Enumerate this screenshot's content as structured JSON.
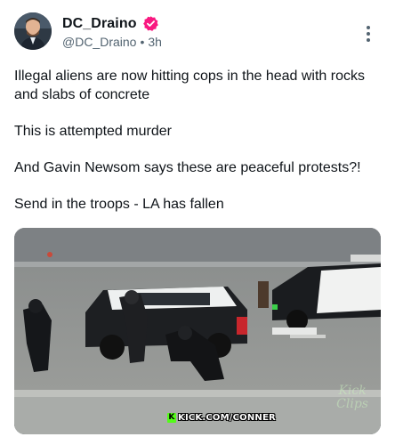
{
  "author": {
    "display_name": "DC_Draino",
    "handle": "@DC_Draino",
    "separator": "•",
    "time_ago": "3h",
    "verified_badge_icon": "verified-badge-icon",
    "badge_color": "#f91880"
  },
  "menu": {
    "icon": "more-vertical-icon"
  },
  "post": {
    "paragraphs": [
      "Illegal aliens are now hitting cops in the head with rocks and slabs of concrete",
      "This is attempted murder",
      "And Gavin Newsom says these are peaceful protests?!",
      "Send in the troops - LA has fallen"
    ]
  },
  "media": {
    "overlay_logo_letter": "K",
    "overlay_text": "KICK.COM/CONNER",
    "watermark_line1": "Kick",
    "watermark_line2": "Clips",
    "accent_color": "#53fc18"
  }
}
